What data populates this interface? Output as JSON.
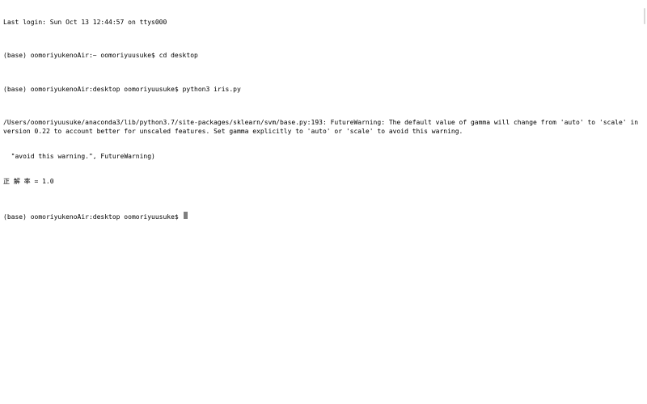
{
  "terminal": {
    "login_line": "Last login: Sun Oct 13 12:44:57 on ttys000",
    "lines": [
      {
        "prompt": "(base) oomoriyukenoAir:~ oomoriyuusuke$ ",
        "command": "cd desktop"
      },
      {
        "prompt": "(base) oomoriyukenoAir:desktop oomoriyuusuke$ ",
        "command": "python3 iris.py"
      }
    ],
    "warning_line1": "/Users/oomoriyuusuke/anaconda3/lib/python3.7/site-packages/sklearn/svm/base.py:193: FutureWarning: The default value of gamma will change from 'auto' to 'scale' in version 0.22 to account better for unscaled features. Set gamma explicitly to 'auto' or 'scale' to avoid this warning.",
    "warning_line2": "  \"avoid this warning.\", FutureWarning)",
    "result_line": "正 解 率 = 1.0",
    "current_prompt": "(base) oomoriyukenoAir:desktop oomoriyuusuke$ "
  }
}
